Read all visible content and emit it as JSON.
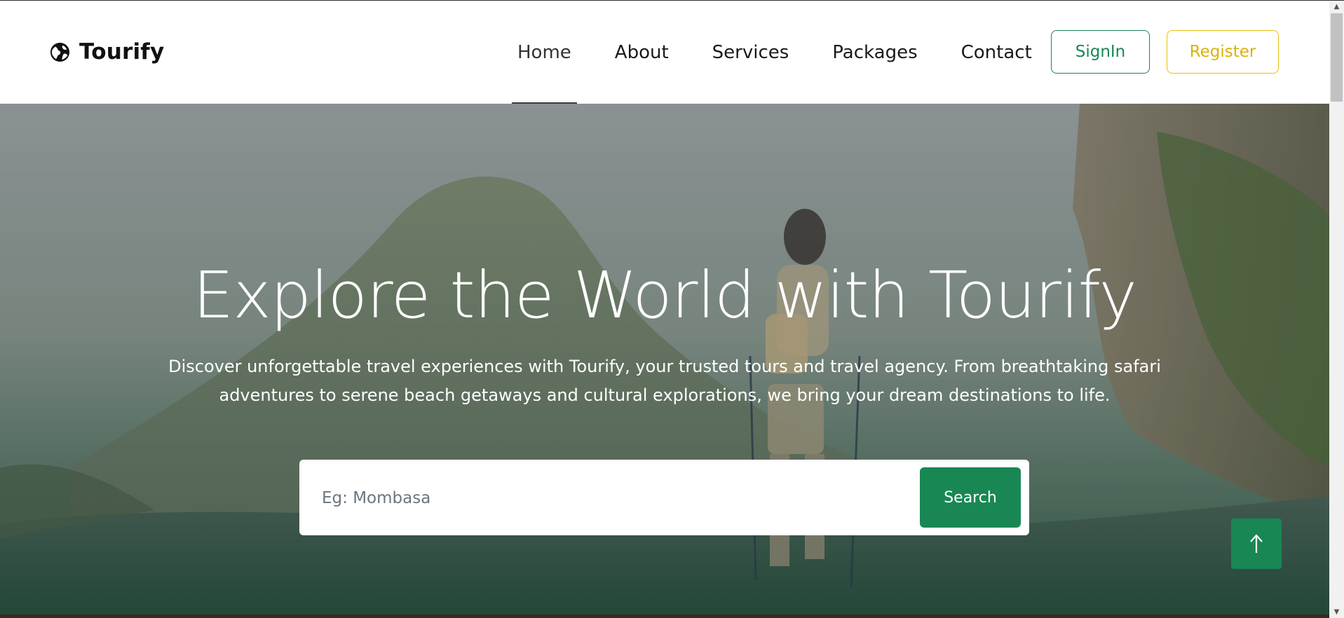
{
  "brand": {
    "name": "Tourify",
    "icon": "globe-icon"
  },
  "nav": {
    "items": [
      {
        "label": "Home",
        "active": true
      },
      {
        "label": "About",
        "active": false
      },
      {
        "label": "Services",
        "active": false
      },
      {
        "label": "Packages",
        "active": false
      },
      {
        "label": "Contact",
        "active": false
      }
    ],
    "signin_label": "SignIn",
    "register_label": "Register"
  },
  "hero": {
    "title": "Explore the World with Tourify",
    "subtitle": "Discover unforgettable travel experiences with Tourify, your trusted tours and travel agency. From breathtaking safari adventures to serene beach getaways and cultural explorations, we bring your dream destinations to life.",
    "search": {
      "placeholder": "Eg: Mombasa",
      "button_label": "Search"
    }
  },
  "back_to_top": {
    "icon": "arrow-up-icon"
  },
  "colors": {
    "primary_green": "#198754",
    "register_yellow": "#e8c10a",
    "text_dark": "#111111"
  }
}
